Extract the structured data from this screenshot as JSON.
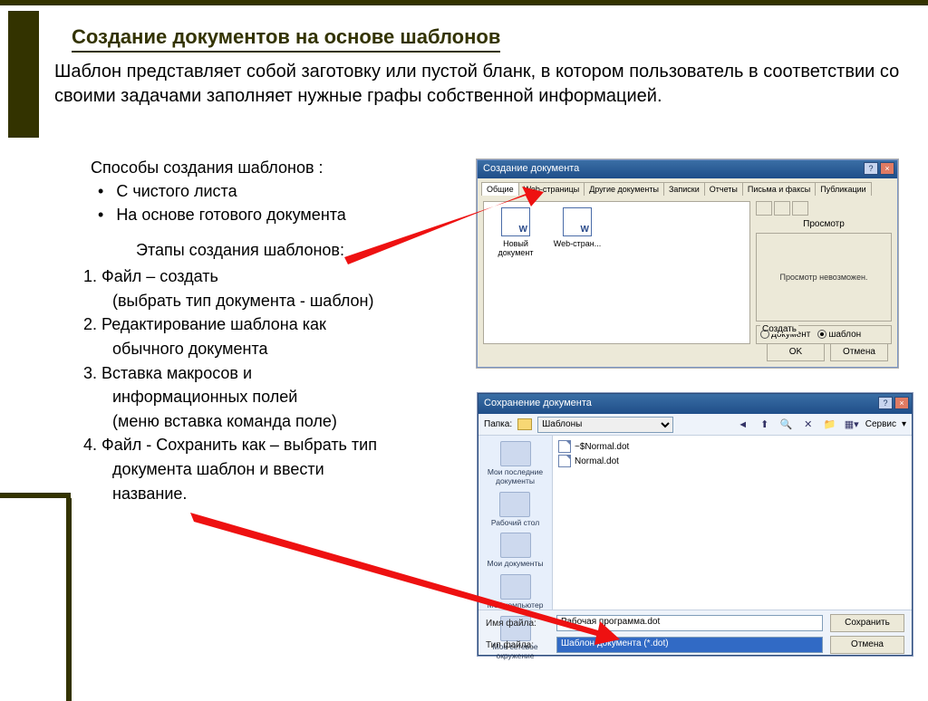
{
  "heading": "Создание документов на основе шаблонов",
  "intro": "Шаблон представляет собой заготовку или пустой бланк, в котором пользователь в соответствии со своими задачами заполняет нужные графы собственной информацией.",
  "ways": {
    "title": "Способы создания шаблонов :",
    "items": [
      "С чистого листа",
      "На основе готового документа"
    ]
  },
  "stages": {
    "title": "Этапы создания шаблонов:",
    "lines": [
      "1. Файл – создать",
      "(выбрать тип документа - шаблон)",
      "2. Редактирование шаблона как",
      "обычного документа",
      "3. Вставка макросов и",
      "информационных полей",
      "(меню вставка команда поле)",
      "4. Файл - Сохранить как – выбрать тип",
      "документа шаблон и ввести",
      "название."
    ]
  },
  "dialog1": {
    "title": "Создание документа",
    "tabs": [
      "Общие",
      "Web-страницы",
      "Другие документы",
      "Записки",
      "Отчеты",
      "Письма и факсы",
      "Публикации"
    ],
    "icons": [
      {
        "label": "Новый документ"
      },
      {
        "label": "Web-стран..."
      }
    ],
    "preview_label": "Просмотр",
    "preview_msg": "Просмотр невозможен.",
    "create_label": "Создать",
    "opt_doc": "документ",
    "opt_tpl": "шаблон",
    "ok": "OK",
    "cancel": "Отмена"
  },
  "dialog2": {
    "title": "Сохранение документа",
    "folder_label": "Папка:",
    "folder_value": "Шаблоны",
    "service": "Сервис",
    "places": [
      "Мои последние документы",
      "Рабочий стол",
      "Мои документы",
      "Мой компьютер",
      "Мое сетевое окружение"
    ],
    "files": [
      "~$Normal.dot",
      "Normal.dot"
    ],
    "name_label": "Имя файла:",
    "name_value": "Рабочая программа.dot",
    "type_label": "Тип файла:",
    "type_value": "Шаблон документа (*.dot)",
    "save": "Сохранить",
    "cancel": "Отмена"
  }
}
